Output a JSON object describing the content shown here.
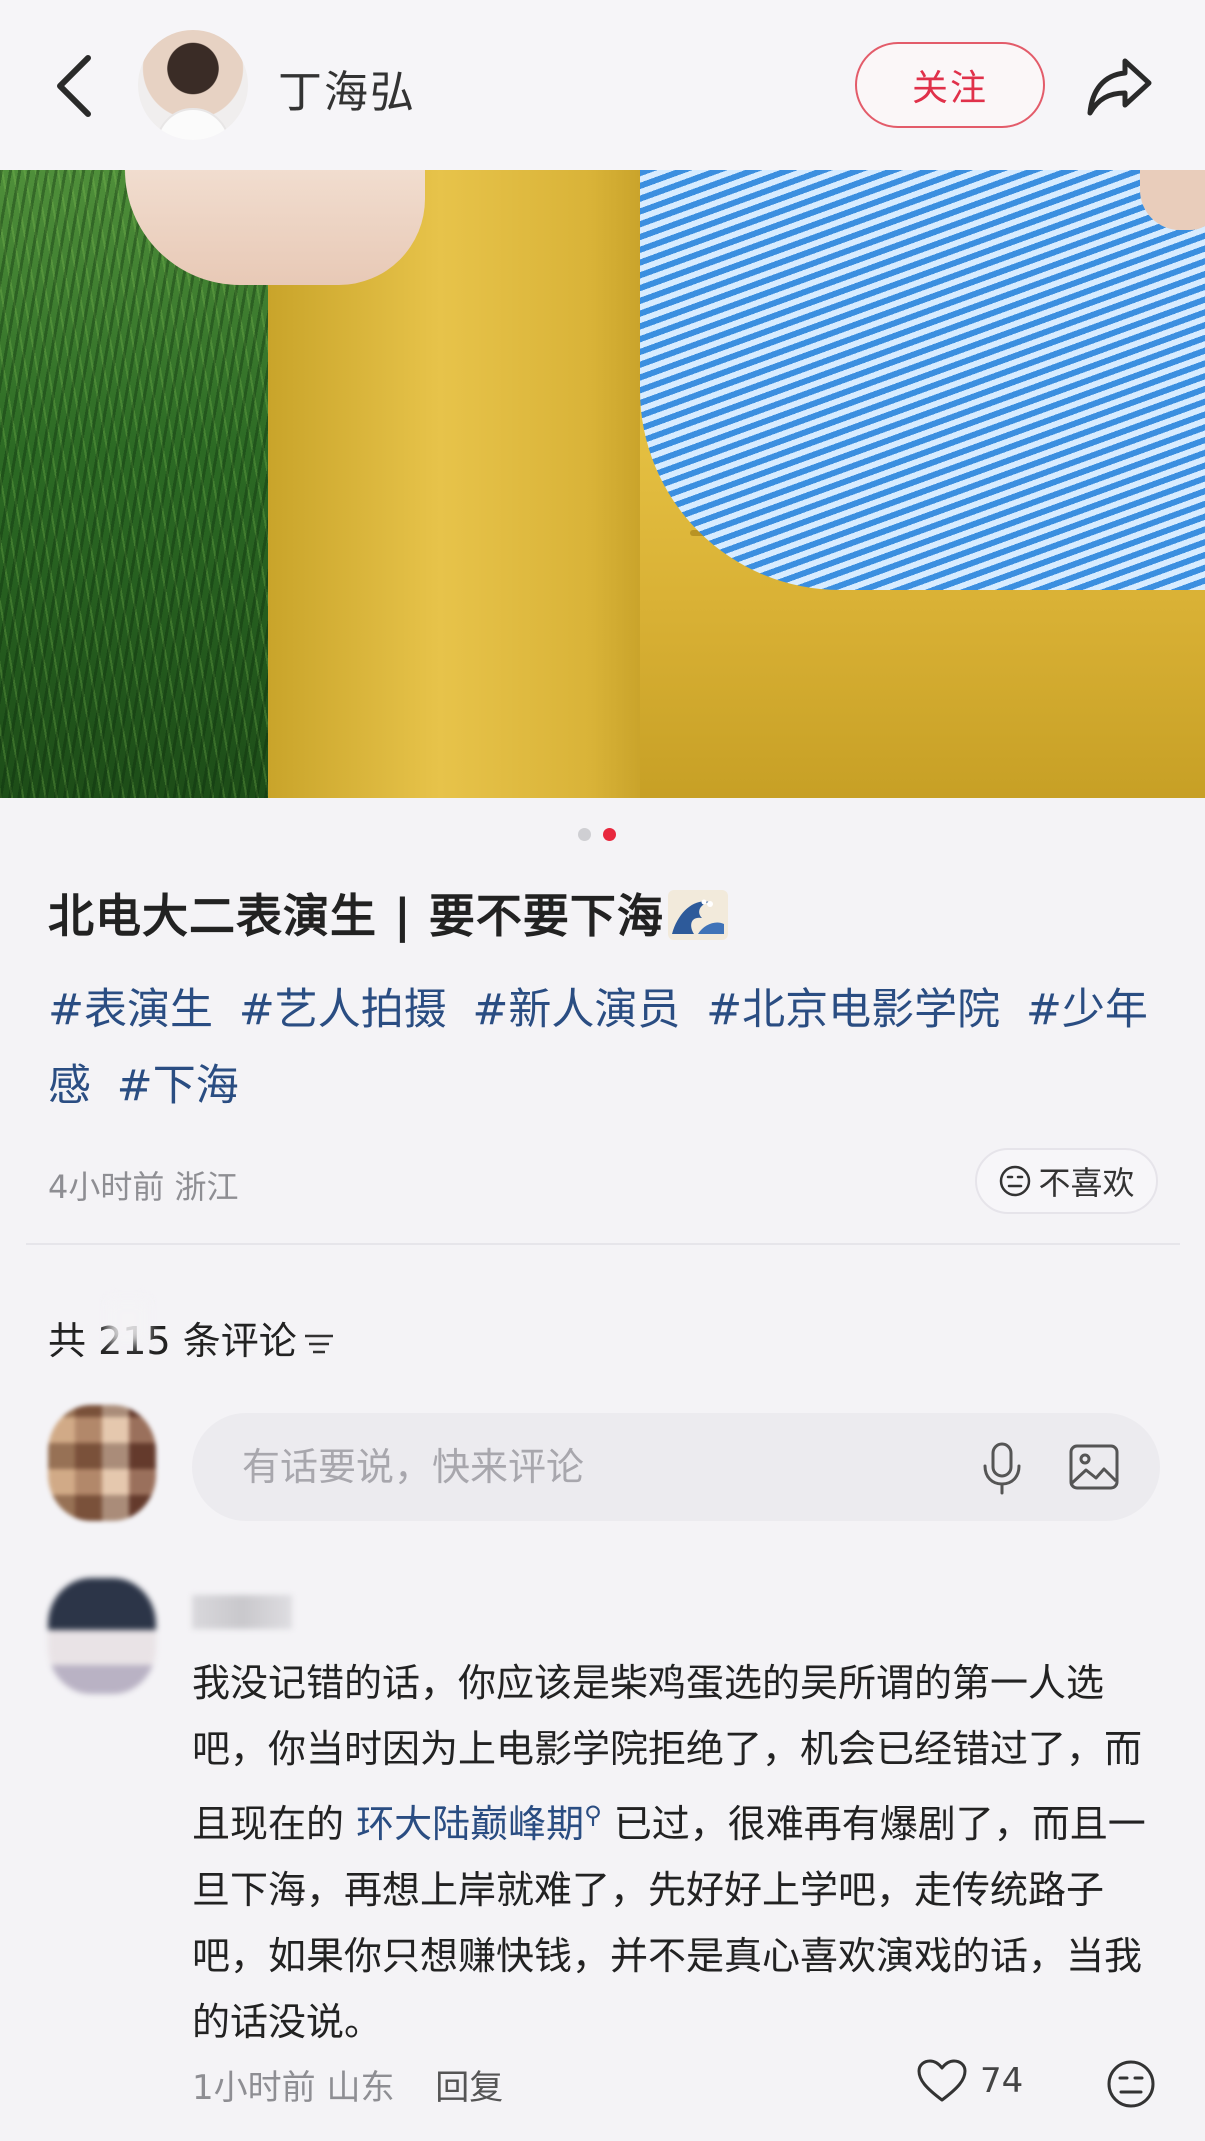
{
  "header": {
    "author_name": "丁海弘",
    "follow_label": "关注"
  },
  "carousel": {
    "total": 2,
    "active": 2
  },
  "post": {
    "title": "北电大二表演生 | 要不要下海",
    "title_emoji": "wave-emoji",
    "tags": [
      "#表演生",
      "#艺人拍摄",
      "#新人演员",
      "#北京电影学院",
      "#少年感",
      "#下海"
    ],
    "time": "4小时前",
    "location": "浙江",
    "dislike_label": "不喜欢"
  },
  "comments_section": {
    "count_text_prefix": "共",
    "count": "215",
    "count_text_suffix": "条评论",
    "input_placeholder": "有话要说，快来评论"
  },
  "comment": {
    "text_part1": "我没记错的话，你应该是柴鸡蛋选的吴所谓的第一人选吧，你当时因为上电影学院拒绝了，机会已经错过了，而且现在的 ",
    "link_text": "环大陆巅峰期",
    "text_part2": " 已过，很难再有爆剧了，而且一旦下海，再想上岸就难了，先好好上学吧，走传统路子吧，如果你只想赚快钱，并不是真心喜欢演戏的话，当我的话没说。",
    "time": "1小时前",
    "location": "山东",
    "reply_label": "回复",
    "likes": "74"
  },
  "colors": {
    "accent_red": "#e0314a",
    "hashtag_blue": "#2a4d82",
    "meta_gray": "#8e8e93"
  }
}
